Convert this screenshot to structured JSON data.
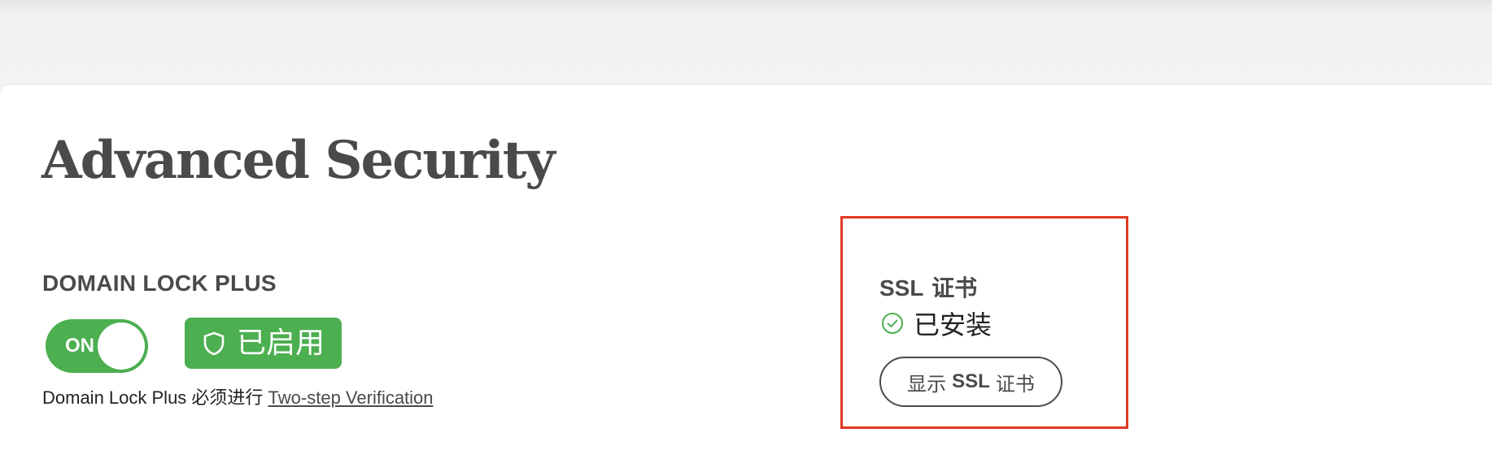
{
  "page": {
    "title": "Advanced Security"
  },
  "domain_lock": {
    "heading": "DOMAIN LOCK PLUS",
    "toggle_label": "ON",
    "toggle_state": "on",
    "badge_icon": "shield-icon",
    "badge_text": "已启用",
    "note_prefix": "Domain Lock Plus 必须进行",
    "note_link": "Two-step Verification"
  },
  "ssl": {
    "title_prefix": "SSL",
    "title_suffix": "证书",
    "status_icon": "check-circle-icon",
    "status_text": "已安装",
    "button_prefix": "显示",
    "button_strong": "SSL",
    "button_suffix": "证书"
  },
  "colors": {
    "accent_green": "#4caf50",
    "highlight_red": "#e03a22",
    "text_gray": "#4a4a4a"
  }
}
